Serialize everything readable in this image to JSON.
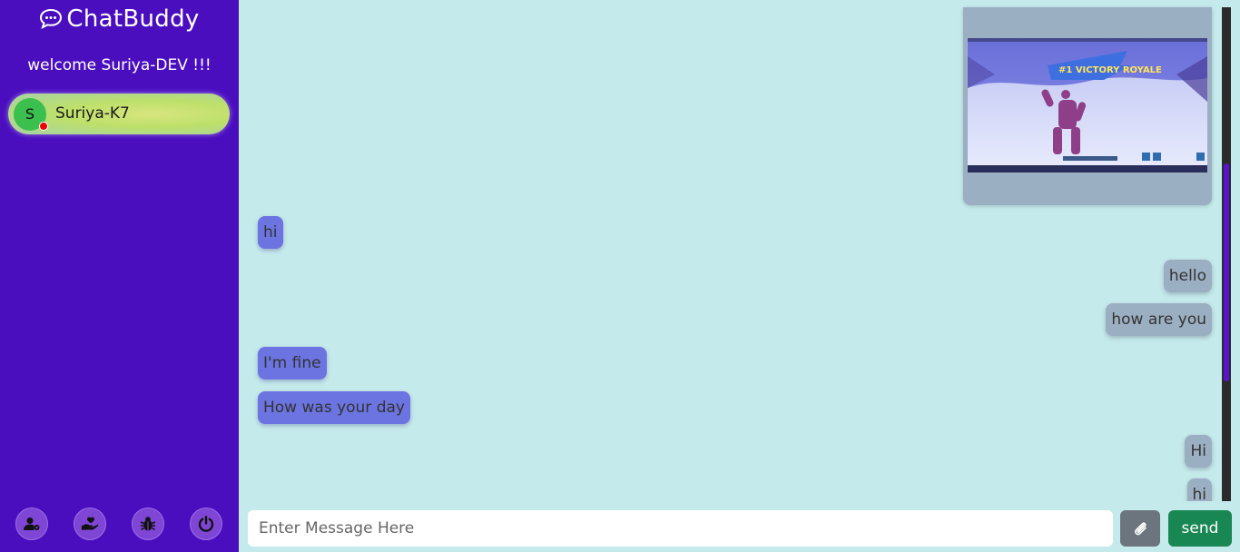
{
  "sidebar": {
    "brand": "ChatBuddy",
    "welcome": "welcome Suriya-DEV !!!",
    "contacts": [
      {
        "initial": "S",
        "name": "Suriya-K7",
        "status": "offline"
      }
    ],
    "actions": [
      {
        "icon": "user-settings-icon"
      },
      {
        "icon": "heart-hand-icon"
      },
      {
        "icon": "bug-icon"
      },
      {
        "icon": "power-icon"
      }
    ]
  },
  "chat": {
    "image_message": {
      "caption_on_image": "#1 VICTORY ROYALE"
    },
    "messages": [
      {
        "dir": "recv",
        "text": "hi"
      },
      {
        "dir": "sent",
        "text": "hello"
      },
      {
        "dir": "sent",
        "text": "how are you"
      },
      {
        "dir": "recv",
        "text": "I'm fine"
      },
      {
        "dir": "recv",
        "text": "How was your day"
      },
      {
        "dir": "sent",
        "text": "Hi"
      },
      {
        "dir": "sent",
        "text": "hi"
      }
    ]
  },
  "composer": {
    "placeholder": "Enter Message Here",
    "send_label": "send",
    "attach_icon": "paperclip-icon"
  },
  "colors": {
    "sidebar": "#4a0ebf",
    "chat_bg": "#c5eaeb",
    "received_bubble": "#6b74e0",
    "sent_bubble": "#9bafc2",
    "send_button": "#198754"
  }
}
